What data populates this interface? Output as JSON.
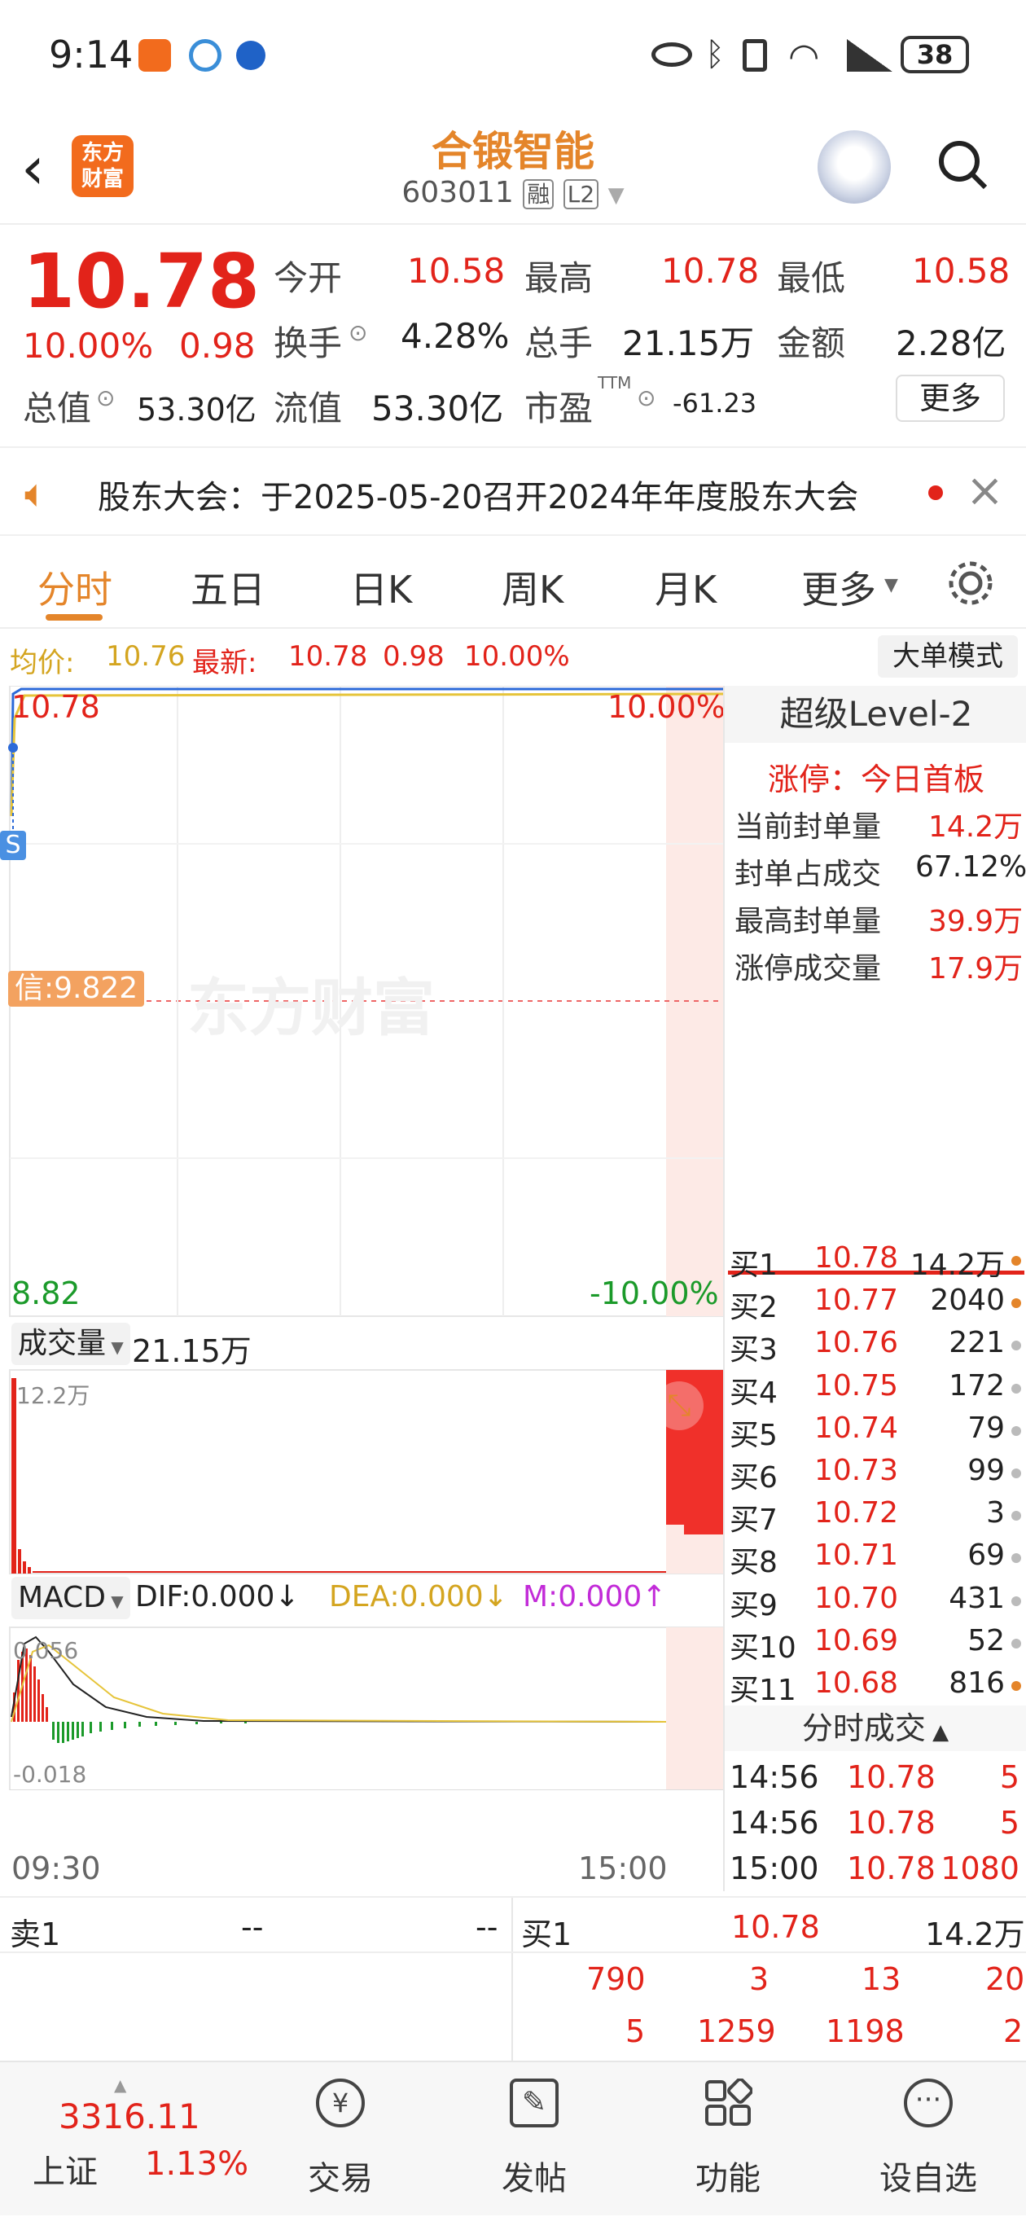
{
  "status": {
    "time": "9:14",
    "battery": "38"
  },
  "header": {
    "title": "合锻智能",
    "code": "603011",
    "tag_rong": "融",
    "tag_l2": "L2",
    "logo_line1": "东方",
    "logo_line2": "财富"
  },
  "quote": {
    "price": "10.78",
    "pct": "10.00%",
    "chg": "0.98",
    "open_label": "今开",
    "open": "10.58",
    "high_label": "最高",
    "high": "10.78",
    "low_label": "最低",
    "low": "10.58",
    "turnover_label": "换手",
    "turnover": "4.28%",
    "volume_label": "总手",
    "volume": "21.15万",
    "amount_label": "金额",
    "amount": "2.28亿",
    "mktcap_label": "总值",
    "mktcap": "53.30亿",
    "float_label": "流值",
    "float": "53.30亿",
    "pe_label": "市盈",
    "pe_sup": "TTM",
    "pe": "-61.23",
    "more": "更多"
  },
  "notice": {
    "text": "股东大会：于2025-05-20召开2024年年度股东大会"
  },
  "tabs": [
    "分时",
    "五日",
    "日K",
    "周K",
    "月K",
    "更多"
  ],
  "chart": {
    "avg_label": "均价:",
    "avg": "10.76",
    "latest_label": "最新:",
    "latest": "10.78",
    "latest_chg": "0.98",
    "latest_pct": "10.00%",
    "big_order": "大单模式",
    "y_top": "10.78",
    "y_top_pct": "10.00%",
    "y_bottom": "8.82",
    "y_bottom_pct": "-10.00%",
    "mid_label": "信:9.822",
    "watermark": "东方财富",
    "s_marker": "S",
    "vol_label": "成交量",
    "vol_total": "21.15万",
    "vol_max": "12.2万",
    "macd_label": "MACD",
    "dif": "DIF:0.000↓",
    "dea": "DEA:0.000↓",
    "m": "M:0.000↑",
    "macd_top": "0.056",
    "macd_bottom": "-0.018",
    "time_start": "09:30",
    "time_end": "15:00"
  },
  "level2": {
    "title": "超级Level-2",
    "limit": "涨停：今日首板",
    "rows": [
      {
        "k": "当前封单量",
        "v": "14.2万"
      },
      {
        "k": "封单占成交",
        "v": "67.12%"
      },
      {
        "k": "最高封单量",
        "v": "39.9万"
      },
      {
        "k": "涨停成交量",
        "v": "17.9万"
      }
    ]
  },
  "orderbook": [
    {
      "l": "买1",
      "p": "10.78",
      "v": "14.2万"
    },
    {
      "l": "买2",
      "p": "10.77",
      "v": "2040"
    },
    {
      "l": "买3",
      "p": "10.76",
      "v": "221"
    },
    {
      "l": "买4",
      "p": "10.75",
      "v": "172"
    },
    {
      "l": "买5",
      "p": "10.74",
      "v": "79"
    },
    {
      "l": "买6",
      "p": "10.73",
      "v": "99"
    },
    {
      "l": "买7",
      "p": "10.72",
      "v": "3"
    },
    {
      "l": "买8",
      "p": "10.71",
      "v": "69"
    },
    {
      "l": "买9",
      "p": "10.70",
      "v": "431"
    },
    {
      "l": "买10",
      "p": "10.69",
      "v": "52"
    },
    {
      "l": "买11",
      "p": "10.68",
      "v": "816"
    }
  ],
  "ticks_title": "分时成交",
  "ticks": [
    {
      "t": "14:56",
      "p": "10.78",
      "v": "5"
    },
    {
      "t": "14:56",
      "p": "10.78",
      "v": "5"
    },
    {
      "t": "15:00",
      "p": "10.78",
      "v": "1080"
    }
  ],
  "book": {
    "sell_label": "卖1",
    "sell_p": "--",
    "sell_v": "--",
    "buy_label": "买1",
    "buy_p": "10.78",
    "buy_v": "14.2万",
    "row1": [
      "790",
      "3",
      "13",
      "20"
    ],
    "row2": [
      "5",
      "1259",
      "1198",
      "2"
    ]
  },
  "nav": {
    "index": "3316.11",
    "index_name": "上证",
    "index_pct": "1.13%",
    "trade": "交易",
    "post": "发帖",
    "func": "功能",
    "watch": "设自选"
  }
}
